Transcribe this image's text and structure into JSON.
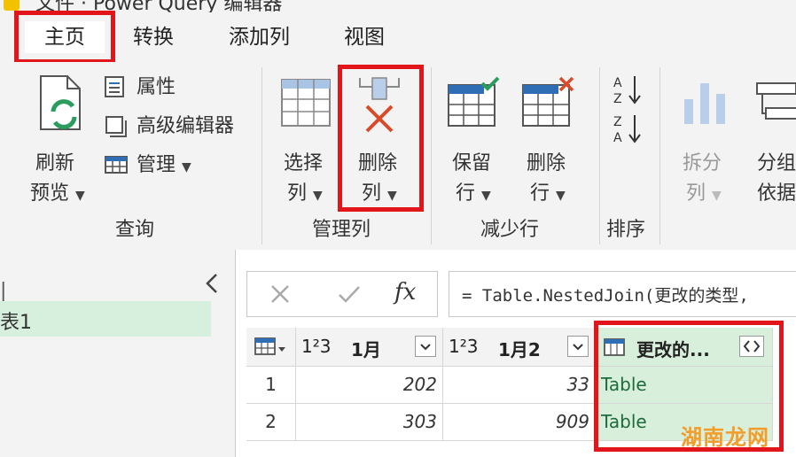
{
  "window": {
    "title": "文件 · Power Query 编辑器"
  },
  "tabs": [
    {
      "label": "主页",
      "active": true
    },
    {
      "label": "转换"
    },
    {
      "label": "添加列"
    },
    {
      "label": "视图"
    }
  ],
  "ribbon": {
    "refresh_preview": {
      "line1": "刷新",
      "line2": "预览"
    },
    "properties_label": "属性",
    "advanced_editor_label": "高级编辑器",
    "manage_label": "管理",
    "query_group_label": "查询",
    "choose_columns": {
      "line1": "选择",
      "line2": "列"
    },
    "remove_columns": {
      "line1": "删除",
      "line2": "列"
    },
    "manage_columns_group_label": "管理列",
    "keep_rows": {
      "line1": "保留",
      "line2": "行"
    },
    "remove_rows": {
      "line1": "删除",
      "line2": "行"
    },
    "reduce_rows_group_label": "减少行",
    "sort_group_label": "排序",
    "split_column": {
      "line1": "拆分",
      "line2": "列"
    },
    "group_by": {
      "line1": "分组",
      "line2": "依据"
    }
  },
  "queries_pane": {
    "selected_query": "表1",
    "collapse_icon": "chevron-left-icon"
  },
  "formula_bar": {
    "fx_label": "fx",
    "formula": "= Table.NestedJoin(更改的类型,"
  },
  "grid": {
    "columns": [
      {
        "type_label": "1²3",
        "name": "1月"
      },
      {
        "type_label": "1²3",
        "name": "1月2"
      },
      {
        "type_label": "table",
        "name": "更改的..."
      }
    ],
    "rows": [
      {
        "index": "1",
        "c1": "202",
        "c2": "33",
        "c3": "Table"
      },
      {
        "index": "2",
        "c1": "303",
        "c2": "909",
        "c3": "Table"
      }
    ]
  },
  "watermark": "湖南龙网",
  "colors": {
    "highlight_red": "#e2151a",
    "selected_green": "#d8efdb",
    "table_text": "#1d6b3a"
  }
}
